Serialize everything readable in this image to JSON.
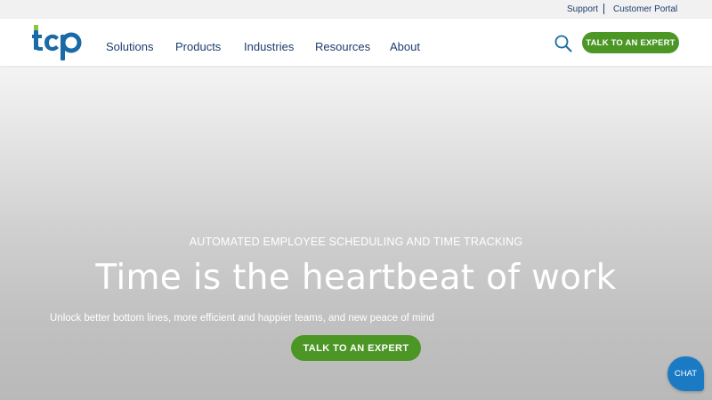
{
  "utility": {
    "support": "Support",
    "customer_portal": "Customer Portal"
  },
  "nav": {
    "items": [
      {
        "label": "Solutions"
      },
      {
        "label": "Products"
      },
      {
        "label": "Industries"
      },
      {
        "label": "Resources"
      },
      {
        "label": "About"
      }
    ],
    "cta": "TALK TO AN EXPERT"
  },
  "hero": {
    "eyebrow": "AUTOMATED EMPLOYEE SCHEDULING AND TIME TRACKING",
    "title": "Time is the heartbeat of work",
    "subtitle": "Unlock better bottom lines, more efficient and happier teams, and new peace of mind",
    "cta": "TALK TO AN EXPERT"
  },
  "chat": {
    "label": "CHAT"
  },
  "logo": {
    "text": "tcp"
  },
  "colors": {
    "brand_navy": "#1d3d6e",
    "brand_green": "#4b9624",
    "logo_blue": "#1a6aa6",
    "logo_green": "#8cc63f",
    "chat_blue": "#1a7bc4"
  },
  "icons": {
    "search": "search-icon"
  }
}
